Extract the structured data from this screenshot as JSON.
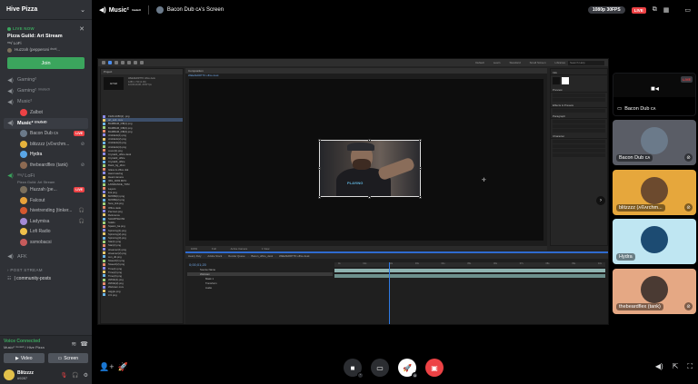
{
  "server": {
    "name": "Hive Pizza"
  },
  "stage": {
    "live_label": "LIVE NOW",
    "title": "Pizza Guild: Art Stream",
    "subtitle": "ᵐᵘ/ LoFi",
    "user": "Huzzah (pepperoni ᵈʳᵘⁱᵈ...",
    "join_label": "Join"
  },
  "channels": [
    {
      "name": "Gaming²",
      "type": "voice"
    },
    {
      "name": "Gaming² ⁽ᵐᵘᵗᵉᵈ⁾",
      "type": "voice"
    },
    {
      "name": "Music²",
      "type": "voice"
    }
  ],
  "zalbot": "Zalbot",
  "music_muted": {
    "name": "Music² ⁽ᵐᵘᵗᵉᵈ⁾",
    "users": [
      {
        "name": "Bacon Dub cᴀ",
        "live": "LIVE",
        "color": "#6b7a8a"
      },
      {
        "name": "blitzzzz (ᴀ©ᴀrchm...",
        "color": "#e6b33c"
      },
      {
        "name": "Hydra",
        "color": "#5aa6e6"
      },
      {
        "name": "thebeardflex (tank)",
        "color": "#8d6a52"
      }
    ]
  },
  "lofi": {
    "name": "ᵐᵘ/ LoFi",
    "sub": "Pizza Guild: Art Stream",
    "users": [
      {
        "name": "Huzzah (pe...",
        "live": "LIVE",
        "color": "#7b6f5c"
      },
      {
        "name": "Falcout",
        "color": "#e8a23a"
      },
      {
        "name": "hivetrending (tinker...",
        "color": "#d4582f"
      },
      {
        "name": "Ladymisa",
        "color": "#a48bd6"
      },
      {
        "name": "Lofi Radio",
        "color": "#f0c14b"
      },
      {
        "name": "ssmobacsi",
        "color": "#c75b5b"
      }
    ]
  },
  "afk": "AFK",
  "post_stream_cat": "POST STREAM",
  "forum": "| community-posts",
  "voice": {
    "connected": "Voice Connected",
    "where": "Music² ⁽ᵐᵘᵗᵉᵈ⁾ / Hive Pizza",
    "video_label": "Video",
    "screen_label": "Screen"
  },
  "user": {
    "name": "Blitzzzz",
    "tag": "#9287"
  },
  "top": {
    "channel": "Music²",
    "channel_sup": "⁽ᵐᵘᵗᵉᵈ⁾",
    "screen": "Bacon Dub cᴀ's Screen",
    "quality": "1080p 30FPS",
    "live": "LIVE"
  },
  "ae": {
    "project_tab": "Project",
    "comp_tab": "Composition",
    "comp_path": "WEEZERRTTD office desk",
    "thumb": "AFTER",
    "meta": [
      "WEEZERRTTD office desk",
      "1280 x 720 (1.00)",
      "Δ 0;00;10;00, 29.97 fps"
    ],
    "workspaces": [
      "Default",
      "Learn",
      "Standard",
      "Small Screen",
      "Libraries"
    ],
    "search": "Search Help",
    "files": [
      "1920x1080(2) .png",
      "art_sub .mov",
      "BAMBAM_DB(1).png",
      "BAMBAM_DB(2).png",
      "BAMBAM_DB(3).png",
      "cirsblank(1).png",
      "cirsblank(2).png",
      "cirsblank(3).png",
      "cirsblank(4).png",
      "cover(1).png",
      "Crystal1_office desk",
      "Crystal2_office",
      "Crystal3_office",
      "Dank_bg_dbcx",
      "Glass & office dsk",
      "Hand waving",
      "Head camera",
      "IMG_4093.MOV",
      "LAWRANCE_TOM",
      "Layers",
      "link.png",
      "MrWBit(1).png",
      "MrWBit(2).png",
      "New_link.png",
      "Office desk",
      "Pacman.png",
      "Reference",
      "SHARTSHOW",
      "Solids",
      "Spawn_ba.png",
      "Spinning(1).png",
      "Spinning(2).png",
      "Spinning(3).png",
      "Star(1).png",
      "Star(2).png",
      "streamer(1).png",
      "streamer(2).png",
      "sun_db.png",
      "Sweetz(1).png",
      "Sweetz(2).png",
      "Time(1).png",
      "Time(2).png",
      "Time(3).png",
      "WAVE(1).png",
      "WAVE(2).png",
      "Webcam.mov",
      "wiggle.png",
      "zzz.png"
    ],
    "selected_file": "art_sub .mov",
    "right_panels": [
      "Info",
      "Preview",
      "Effects & Presets",
      "Paragraph",
      "Character"
    ],
    "viewbar": [
      "100%",
      "Full",
      "Active Camera",
      "1 View"
    ],
    "video_text": "PLAYING",
    "timeline_tabs": [
      "Heavy Duty",
      "Adobe Stock",
      "Render Queue",
      "Bacon_office_desk",
      "WEEZERRTTD office desk"
    ],
    "timecode": "0;00;01;20",
    "layers": [
      "Source Name",
      "Webcam",
      "Mask 1",
      "Transform",
      "Audio"
    ],
    "ruler": [
      "0s",
      "01s",
      "02s",
      "03s",
      "04s",
      "05s",
      "06s",
      "07s",
      "08s",
      "09s",
      "10s"
    ]
  },
  "tiles": [
    {
      "name": "Bacon Dub cᴀ",
      "type": "screen",
      "live": "LIVE"
    },
    {
      "name": "Bacon Dub cᴀ",
      "bg": "#5a5d66",
      "av": "#6b7a8a"
    },
    {
      "name": "blitzzzz (ᴀ©ᴀrchm...",
      "bg": "#e6a73c",
      "av": "#6c4a2e"
    },
    {
      "name": "Hydra",
      "bg": "#bfe6f2",
      "av": "#1c4b72"
    },
    {
      "name": "thebeardflex (tank)",
      "bg": "#e5a884",
      "av": "#4a3a33"
    }
  ]
}
